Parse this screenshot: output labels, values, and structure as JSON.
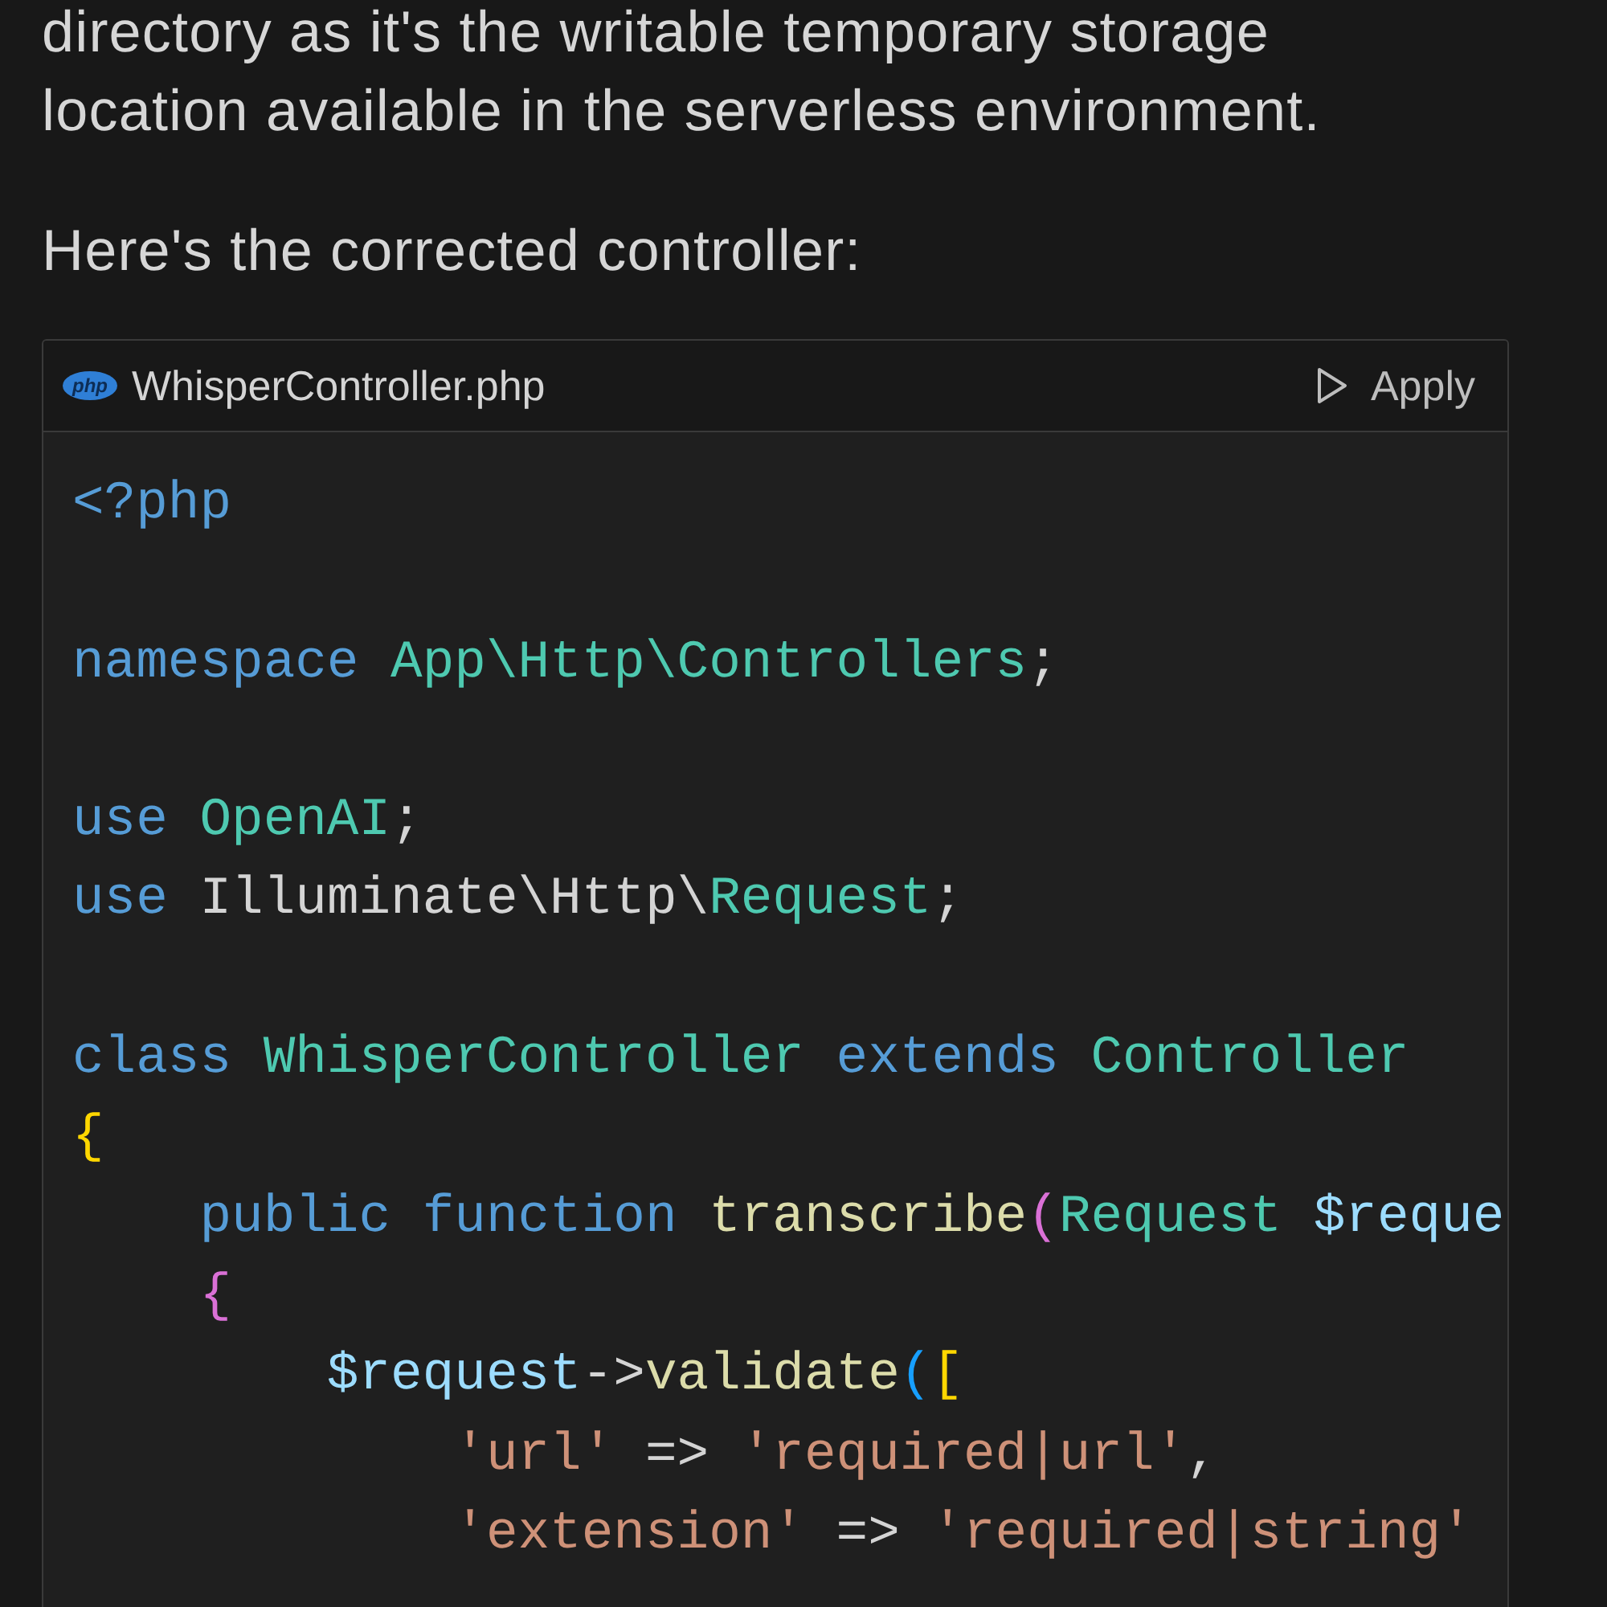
{
  "paragraphs": [
    "directory as it's the writable temporary storage location available in the serverless environment.",
    "Here's the corrected controller:"
  ],
  "code_block": {
    "filename": "WhisperController.php",
    "language_badge": "php",
    "apply_label": "Apply",
    "lines": [
      {
        "kind": "code",
        "tokens": [
          {
            "text": "<?php",
            "kind": "keyword"
          }
        ]
      },
      {
        "kind": "blank"
      },
      {
        "kind": "code",
        "tokens": [
          {
            "text": "namespace ",
            "kind": "keyword"
          },
          {
            "text": "App\\Http\\Controllers",
            "kind": "type"
          },
          {
            "text": ";",
            "kind": "plain"
          }
        ]
      },
      {
        "kind": "blank"
      },
      {
        "kind": "code",
        "tokens": [
          {
            "text": "use ",
            "kind": "keyword"
          },
          {
            "text": "OpenAI",
            "kind": "type"
          },
          {
            "text": ";",
            "kind": "plain"
          }
        ]
      },
      {
        "kind": "code",
        "tokens": [
          {
            "text": "use",
            "kind": "keyword"
          },
          {
            "text": " Illuminate\\Http\\",
            "kind": "plain"
          },
          {
            "text": "Request",
            "kind": "type"
          },
          {
            "text": ";",
            "kind": "plain"
          }
        ]
      },
      {
        "kind": "blank"
      },
      {
        "kind": "code",
        "tokens": [
          {
            "text": "class ",
            "kind": "keyword"
          },
          {
            "text": "WhisperController ",
            "kind": "type"
          },
          {
            "text": "extends ",
            "kind": "keyword"
          },
          {
            "text": "Controller",
            "kind": "type"
          }
        ]
      },
      {
        "kind": "code",
        "tokens": [
          {
            "text": "{",
            "kind": "bracket1"
          }
        ]
      },
      {
        "kind": "code",
        "tokens": [
          {
            "text": "    public function ",
            "kind": "keyword"
          },
          {
            "text": "transcribe",
            "kind": "function"
          },
          {
            "text": "(",
            "kind": "bracket2"
          },
          {
            "text": "Request ",
            "kind": "type"
          },
          {
            "text": "$reque",
            "kind": "variable"
          }
        ]
      },
      {
        "kind": "code",
        "tokens": [
          {
            "text": "    {",
            "kind": "bracket2"
          }
        ]
      },
      {
        "kind": "code",
        "tokens": [
          {
            "text": "        $request",
            "kind": "variable"
          },
          {
            "text": "->",
            "kind": "plain"
          },
          {
            "text": "validate",
            "kind": "function"
          },
          {
            "text": "(",
            "kind": "bracket3"
          },
          {
            "text": "[",
            "kind": "bracket1"
          }
        ]
      },
      {
        "kind": "code",
        "tokens": [
          {
            "text": "            'url'",
            "kind": "string"
          },
          {
            "text": " => ",
            "kind": "plain"
          },
          {
            "text": "'required|url'",
            "kind": "string"
          },
          {
            "text": ",",
            "kind": "plain"
          }
        ]
      },
      {
        "kind": "code",
        "tokens": [
          {
            "text": "            'extension'",
            "kind": "string"
          },
          {
            "text": " => ",
            "kind": "plain"
          },
          {
            "text": "'required|string'",
            "kind": "string"
          }
        ]
      }
    ]
  }
}
